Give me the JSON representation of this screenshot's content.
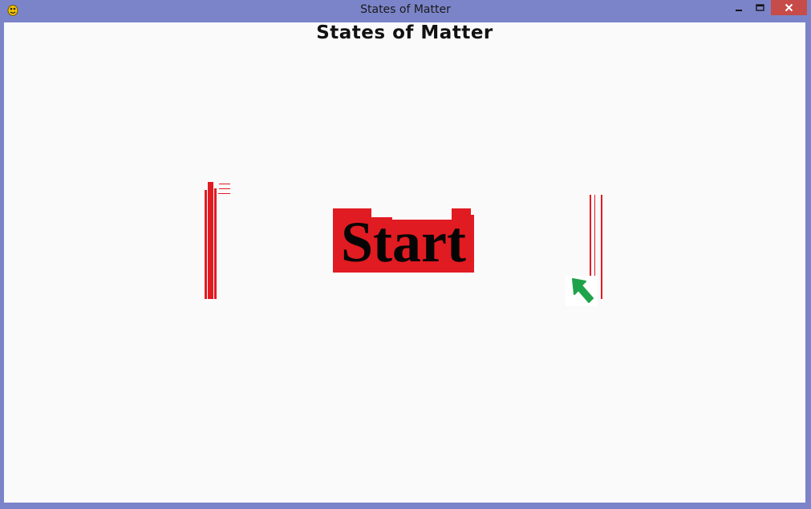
{
  "window": {
    "title": "States of Matter",
    "icon": "pygame-snake-icon",
    "controls": [
      "minimize",
      "maximize",
      "close"
    ]
  },
  "game": {
    "title": "States of Matter",
    "start_label": "Start",
    "colors": {
      "start_bg": "#e11b22",
      "arrow": "#1fa34a",
      "titlebar": "#7b84c8",
      "close": "#c74b48"
    }
  }
}
